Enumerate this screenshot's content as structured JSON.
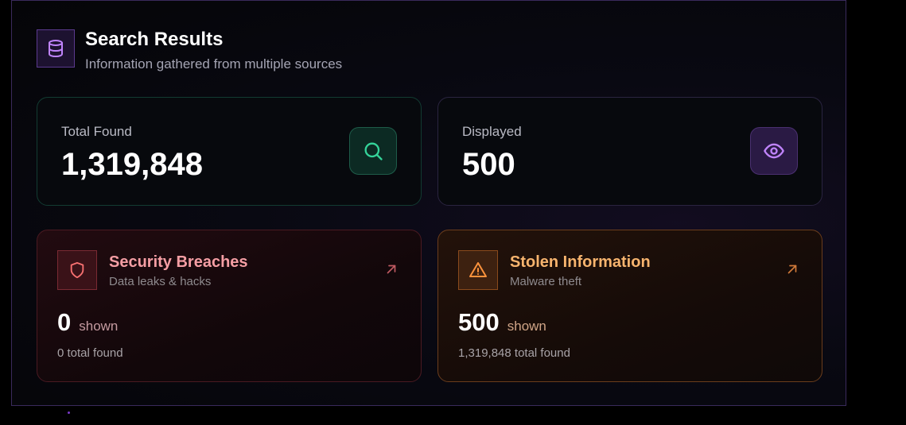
{
  "header": {
    "icon": "database-icon",
    "title": "Search Results",
    "subtitle": "Information gathered from multiple sources"
  },
  "stats": {
    "total_found": {
      "label": "Total Found",
      "value": "1,319,848",
      "icon": "search-icon",
      "color": "#34d399"
    },
    "displayed": {
      "label": "Displayed",
      "value": "500",
      "icon": "eye-icon",
      "color": "#c084fc"
    }
  },
  "categories": {
    "breaches": {
      "icon": "shield-icon",
      "title": "Security Breaches",
      "subtitle": "Data leaks & hacks",
      "count": "0",
      "shown_label": "shown",
      "total": "0 total found",
      "color": "#f87171"
    },
    "stolen": {
      "icon": "warning-icon",
      "title": "Stolen Information",
      "subtitle": "Malware theft",
      "count": "500",
      "shown_label": "shown",
      "total": "1,319,848 total found",
      "color": "#fb923c"
    }
  }
}
